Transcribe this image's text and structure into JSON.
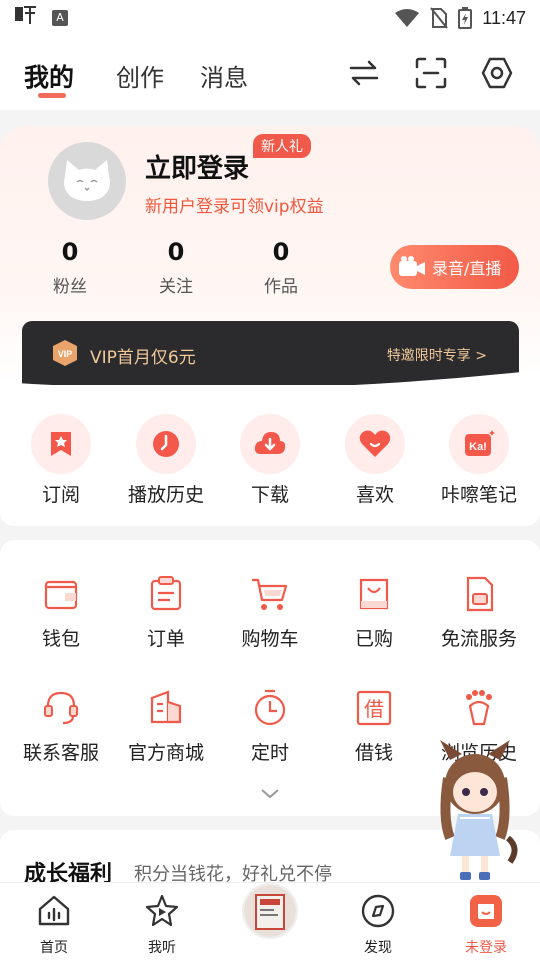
{
  "status_bar": {
    "time": "11:47"
  },
  "header": {
    "tabs": [
      {
        "label": "我的",
        "active": true
      },
      {
        "label": "创作",
        "active": false
      },
      {
        "label": "消息",
        "active": false
      }
    ]
  },
  "profile": {
    "login_title": "立即登录",
    "new_user_badge": "新人礼",
    "login_subtitle": "新用户登录可领vip权益",
    "stats": [
      {
        "value": "0",
        "label": "粉丝"
      },
      {
        "value": "0",
        "label": "关注"
      },
      {
        "value": "0",
        "label": "作品"
      }
    ],
    "record_button": "录音/直播"
  },
  "vip_bar": {
    "text": "VIP首月仅6元",
    "link": "特邀限时专享 >"
  },
  "shortcuts": [
    {
      "label": "订阅",
      "icon": "subscribe-icon"
    },
    {
      "label": "播放历史",
      "icon": "history-icon"
    },
    {
      "label": "下载",
      "icon": "download-icon"
    },
    {
      "label": "喜欢",
      "icon": "heart-icon"
    },
    {
      "label": "咔嚓笔记",
      "icon": "kaca-notes-icon"
    }
  ],
  "services": [
    {
      "label": "钱包",
      "icon": "wallet-icon"
    },
    {
      "label": "订单",
      "icon": "order-icon"
    },
    {
      "label": "购物车",
      "icon": "cart-icon"
    },
    {
      "label": "已购",
      "icon": "purchased-bag-icon"
    },
    {
      "label": "免流服务",
      "icon": "sim-card-icon"
    },
    {
      "label": "联系客服",
      "icon": "headset-icon"
    },
    {
      "label": "官方商城",
      "icon": "store-icon"
    },
    {
      "label": "定时",
      "icon": "timer-icon"
    },
    {
      "label": "借钱",
      "icon": "loan-icon"
    },
    {
      "label": "浏览历史",
      "icon": "footprint-icon"
    }
  ],
  "growth": {
    "title": "成长福利",
    "subtitle": "积分当钱花，好礼兑不停"
  },
  "bottom_nav": [
    {
      "label": "首页",
      "icon": "home-icon"
    },
    {
      "label": "我听",
      "icon": "my-listen-icon"
    },
    {
      "label": "发现",
      "icon": "discover-icon"
    },
    {
      "label": "未登录",
      "icon": "profile-icon"
    }
  ],
  "colors": {
    "accent": "#f05a4a",
    "vip_gold": "#f2c89a",
    "vip_dark": "#2b2b2d"
  }
}
